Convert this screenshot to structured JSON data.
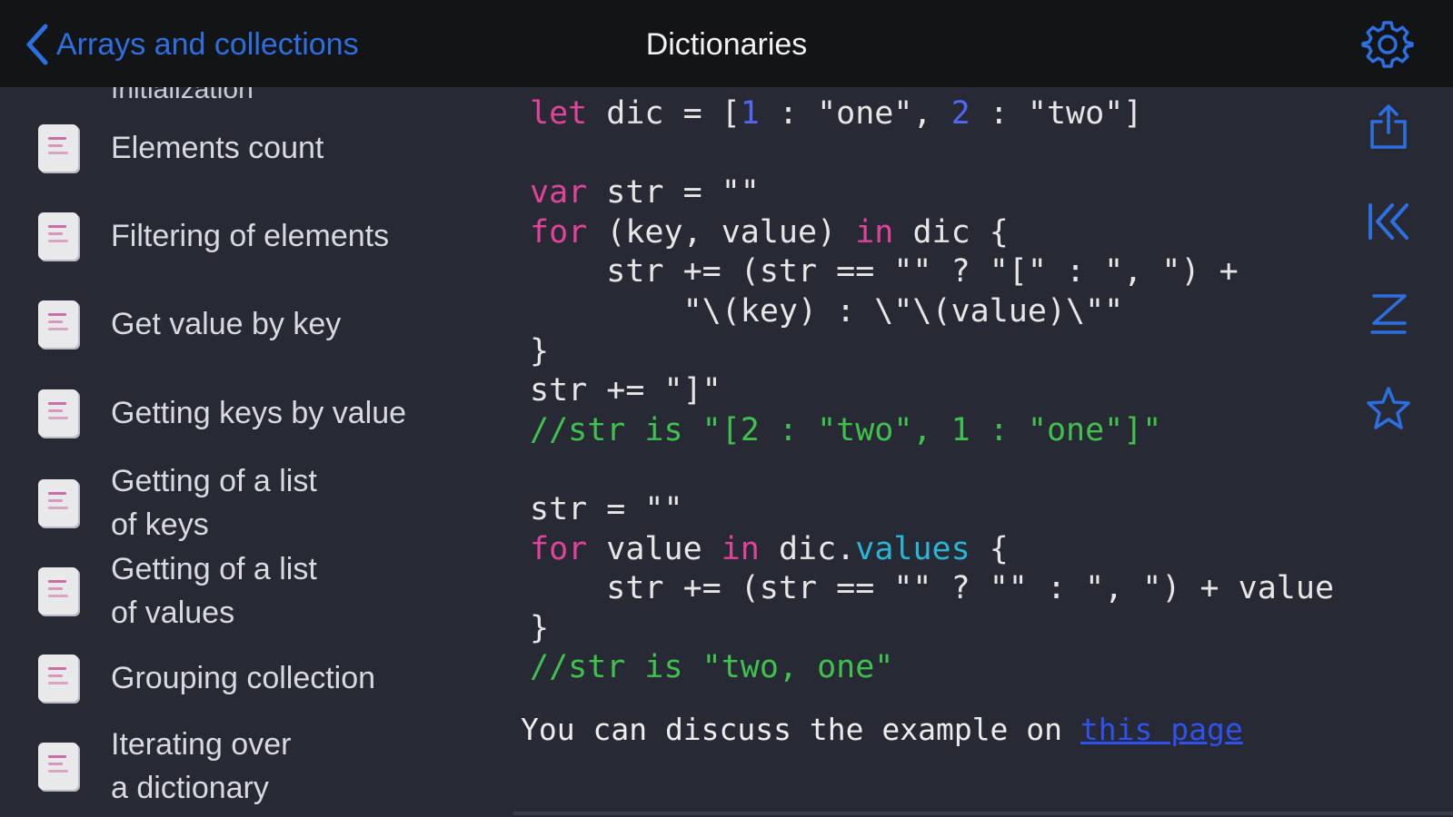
{
  "nav": {
    "back_label": "Arrays and collections",
    "title": "Dictionaries"
  },
  "sidebar": {
    "cut_off_item": "Initialization",
    "items": [
      {
        "label": "Elements count"
      },
      {
        "label": "Filtering of elements"
      },
      {
        "label": "Get value by key"
      },
      {
        "label": "Getting keys by value"
      },
      {
        "label": "Getting of a list\nof keys"
      },
      {
        "label": "Getting of a list\nof values"
      },
      {
        "label": "Grouping collection"
      },
      {
        "label": "Iterating over\na dictionary"
      }
    ]
  },
  "code": {
    "line1": {
      "kw": "let",
      "a": " dic = [",
      "n1": "1",
      "b": " : ",
      "s1": "\"one\"",
      "c": ", ",
      "n2": "2",
      "d": " : ",
      "s2": "\"two\"",
      "e": "]"
    },
    "line3": {
      "kw": "var",
      "rest": " str = \"\""
    },
    "line4": {
      "kw1": "for",
      "a": " (key, value) ",
      "kw2": "in",
      "b": " dic {"
    },
    "line5": "    str += (str == \"\" ? \"[\" : \", \") +",
    "line6": "        \"\\(key) : \\\"\\(value)\\\"\"",
    "line7": "}",
    "line8": "str += \"]\"",
    "line9": "//str is \"[2 : \"two\", 1 : \"one\"]\"",
    "line11": "str = \"\"",
    "line12": {
      "kw1": "for",
      "a": " value ",
      "kw2": "in",
      "b": " dic.",
      "prop": "values",
      "c": " {"
    },
    "line13": "    str += (str == \"\" ? \"\" : \", \") + value",
    "line14": "}",
    "line15": "//str is \"two, one\""
  },
  "discuss": {
    "text": "You can discuss the example on ",
    "link": "this page"
  },
  "colors": {
    "accent": "#2d6fe0",
    "keyword": "#e1439b",
    "number": "#5367f2",
    "comment": "#3ec24d",
    "property": "#2ab5d4",
    "link": "#2f52ee"
  },
  "icons": {
    "back": "chevron-left-icon",
    "settings": "gear-icon",
    "share": "share-icon",
    "first": "first-page-icon",
    "sort": "sort-az-icon",
    "favorite": "star-icon",
    "item": "document-icon"
  }
}
